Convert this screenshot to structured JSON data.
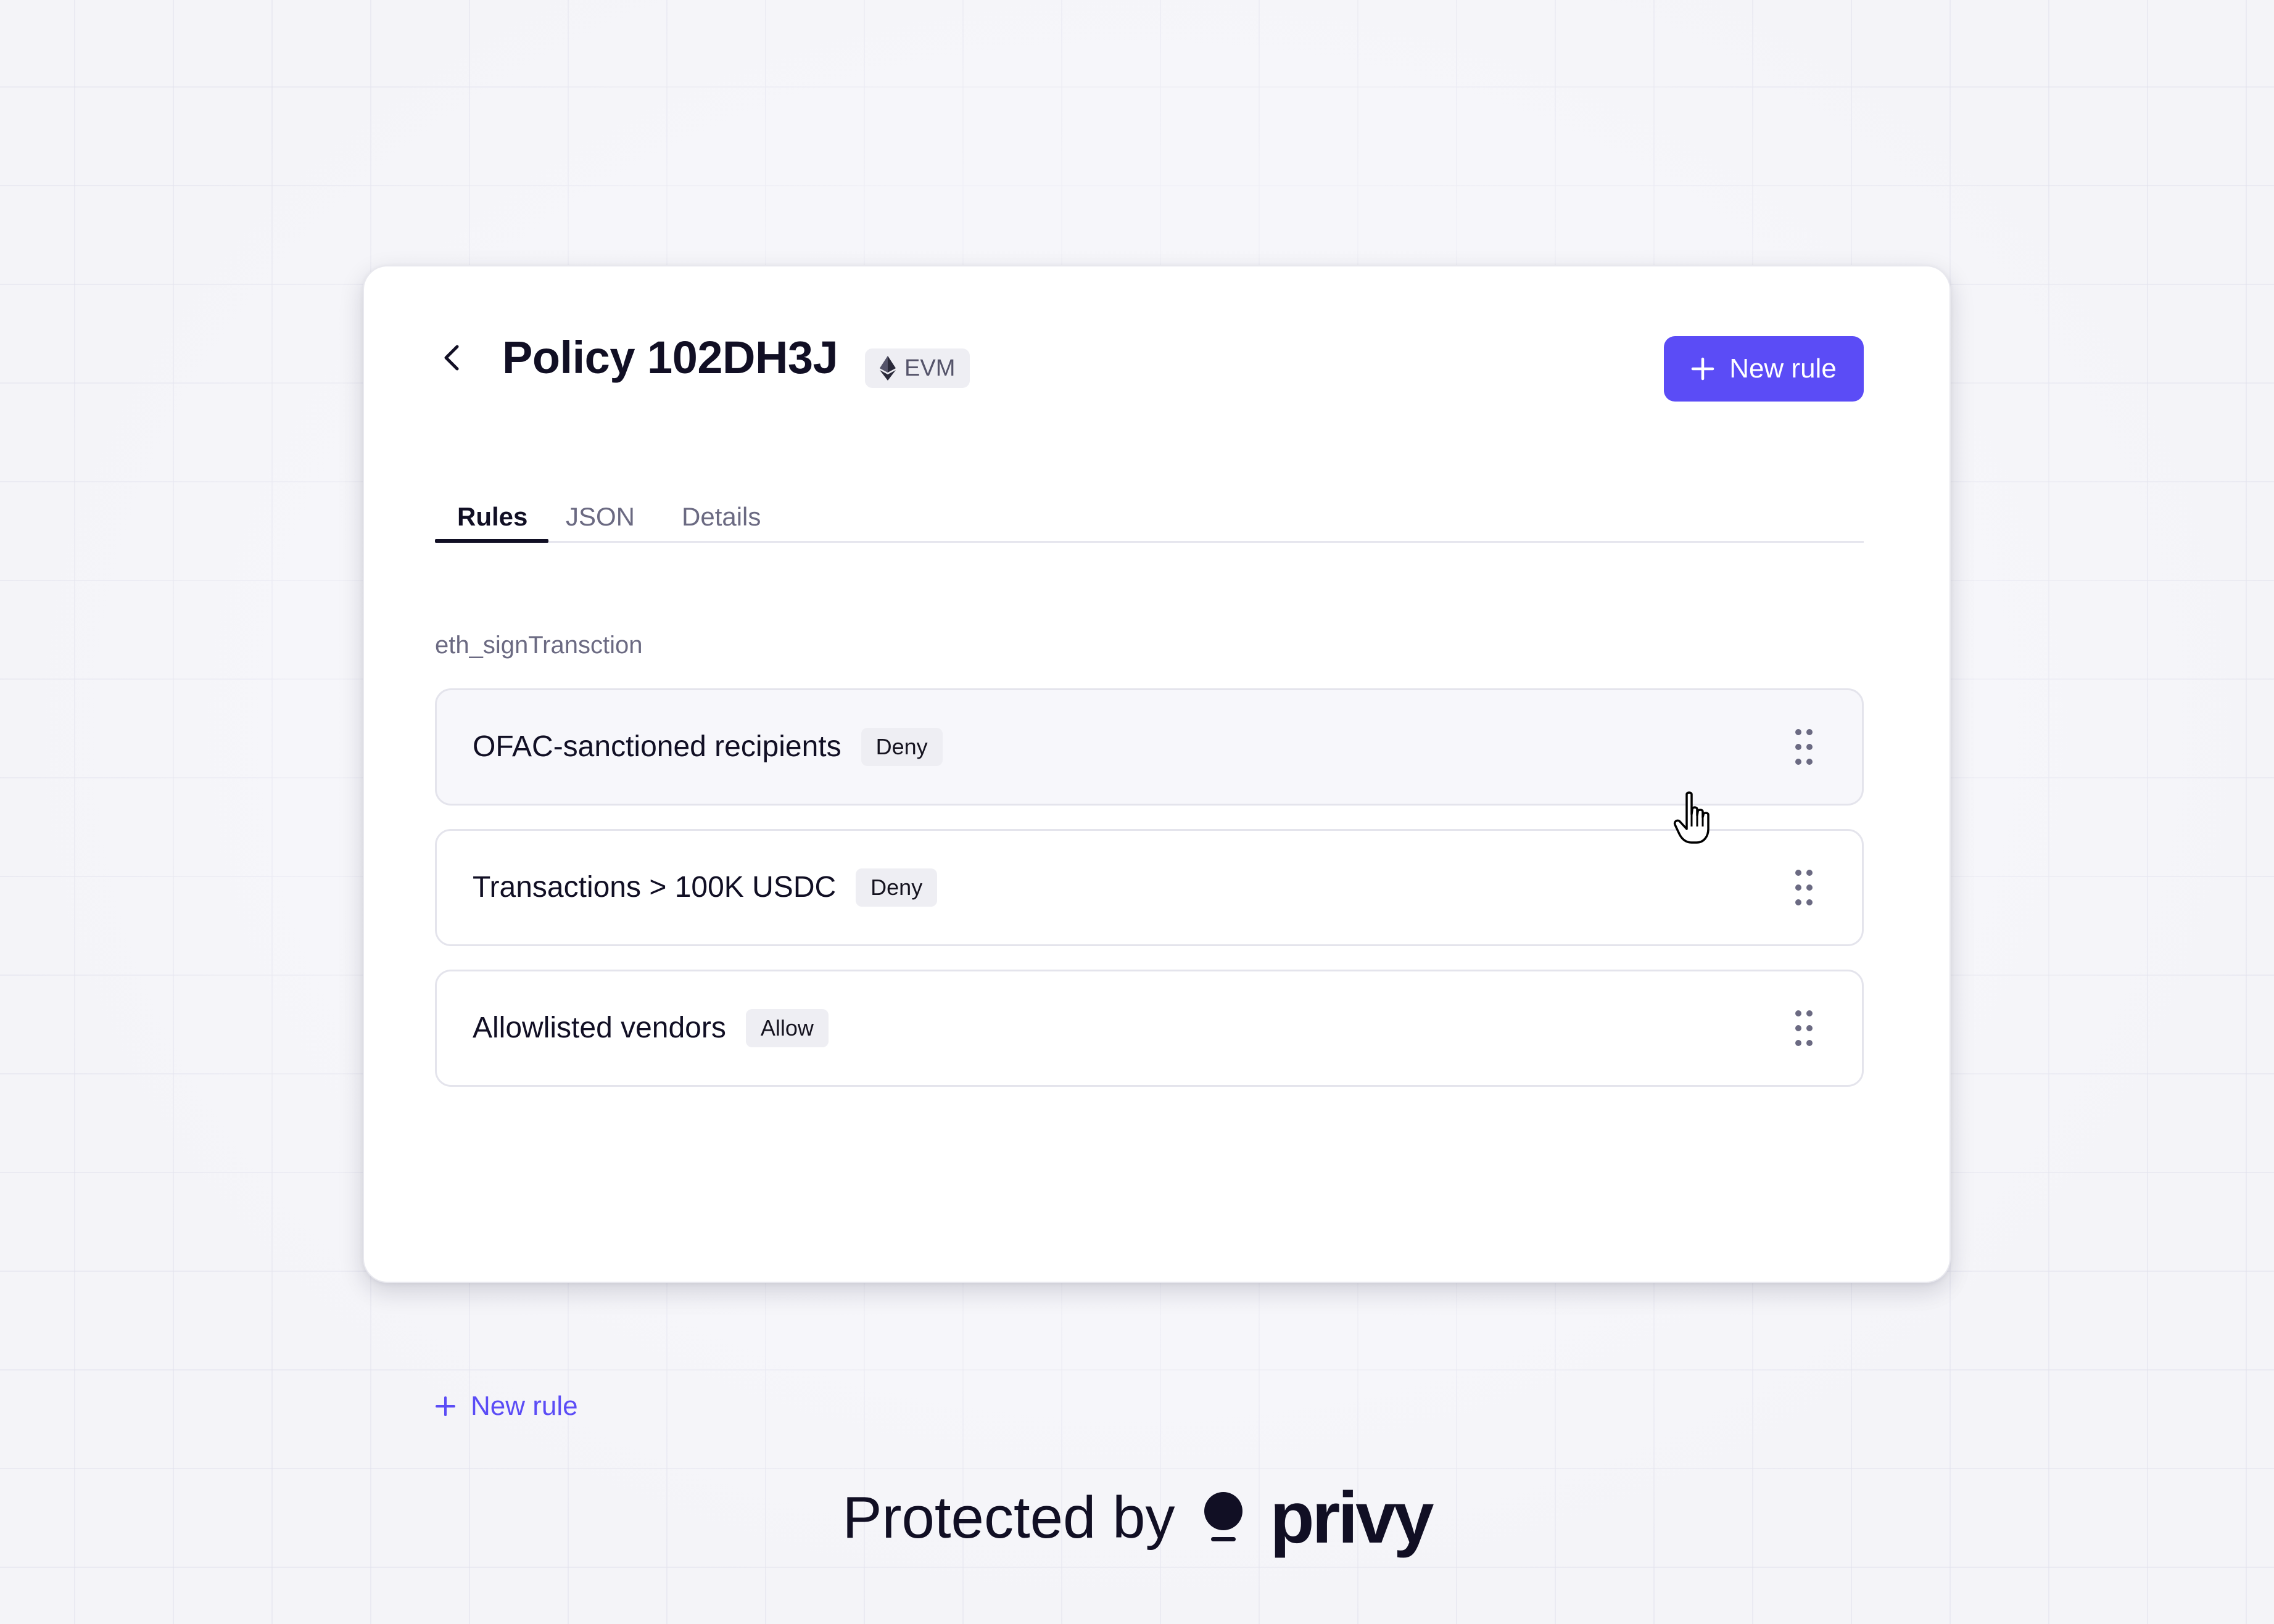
{
  "header": {
    "title": "Policy 102DH3J",
    "chain_badge": "EVM",
    "chain_icon": "ethereum-icon",
    "new_rule_button": "New rule"
  },
  "tabs": [
    {
      "label": "Rules",
      "active": true
    },
    {
      "label": "JSON",
      "active": false
    },
    {
      "label": "Details",
      "active": false
    }
  ],
  "section": {
    "label": "eth_signTransction"
  },
  "rules": [
    {
      "name": "OFAC-sanctioned recipients",
      "action": "Deny"
    },
    {
      "name": "Transactions > 100K USDC",
      "action": "Deny"
    },
    {
      "name": "Allowlisted vendors",
      "action": "Allow"
    }
  ],
  "add_rule_link": "New rule",
  "footer": {
    "text": "Protected by",
    "brand": "privy"
  },
  "colors": {
    "accent": "#5b4cf6",
    "text_primary": "#110f24",
    "text_secondary": "#6b6a82",
    "badge_bg": "#eeeef3",
    "background": "#f4f4f8"
  }
}
